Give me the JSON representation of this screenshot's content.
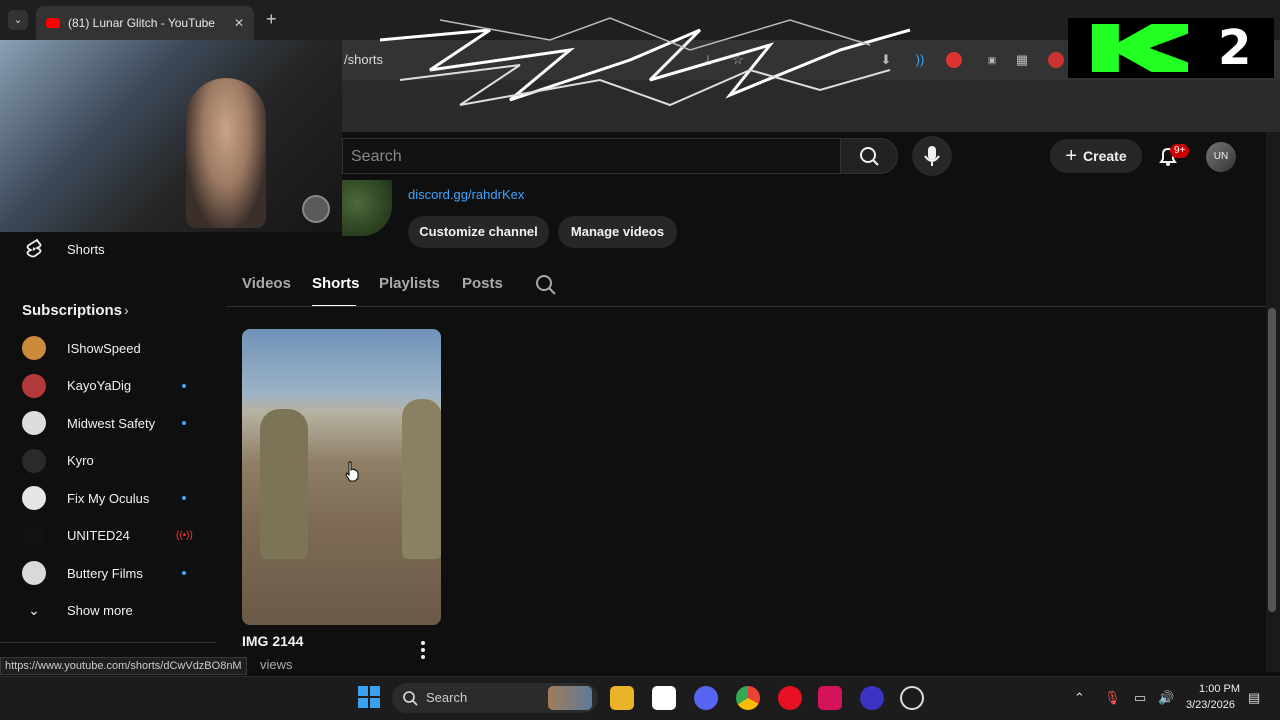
{
  "browser": {
    "tab_title": "(81) Lunar Glitch - YouTube",
    "address_fragment": "/shorts",
    "status_url": "https://www.youtube.com/shorts/dCwVdzBO8nM"
  },
  "header": {
    "search_placeholder": "Search",
    "create_label": "Create",
    "notification_badge": "9+",
    "avatar_initials": "UN"
  },
  "channel": {
    "discord_link": "discord.gg/rahdrKex",
    "customize_label": "Customize channel",
    "manage_label": "Manage videos",
    "tabs": [
      "Videos",
      "Shorts",
      "Playlists",
      "Posts"
    ],
    "active_tab": "Shorts"
  },
  "sidebar": {
    "shorts_label": "Shorts",
    "subscriptions_label": "Subscriptions",
    "subscriptions": [
      {
        "name": "IShowSpeed",
        "indicator": "none",
        "color": "#c98a3a"
      },
      {
        "name": "KayoYaDig",
        "indicator": "dot",
        "color": "#b33a3a"
      },
      {
        "name": "Midwest Safety",
        "indicator": "dot",
        "color": "#dddddd"
      },
      {
        "name": "Kyro",
        "indicator": "none",
        "color": "#2a2a2a"
      },
      {
        "name": "Fix My Oculus",
        "indicator": "dot",
        "color": "#e6e6e6"
      },
      {
        "name": "UNITED24",
        "indicator": "live",
        "color": "#111111"
      },
      {
        "name": "Buttery Films",
        "indicator": "dot",
        "color": "#d9d9d9"
      }
    ],
    "show_more_label": "Show more"
  },
  "short": {
    "title": "IMG 2144",
    "views": "views"
  },
  "taskbar": {
    "search_label": "Search",
    "time": "1:00 PM",
    "date": "3/23/2026"
  },
  "colors": {
    "accent_link": "#3ea6ff",
    "badge_red": "#cc0000",
    "background": "#0f0f0f"
  }
}
